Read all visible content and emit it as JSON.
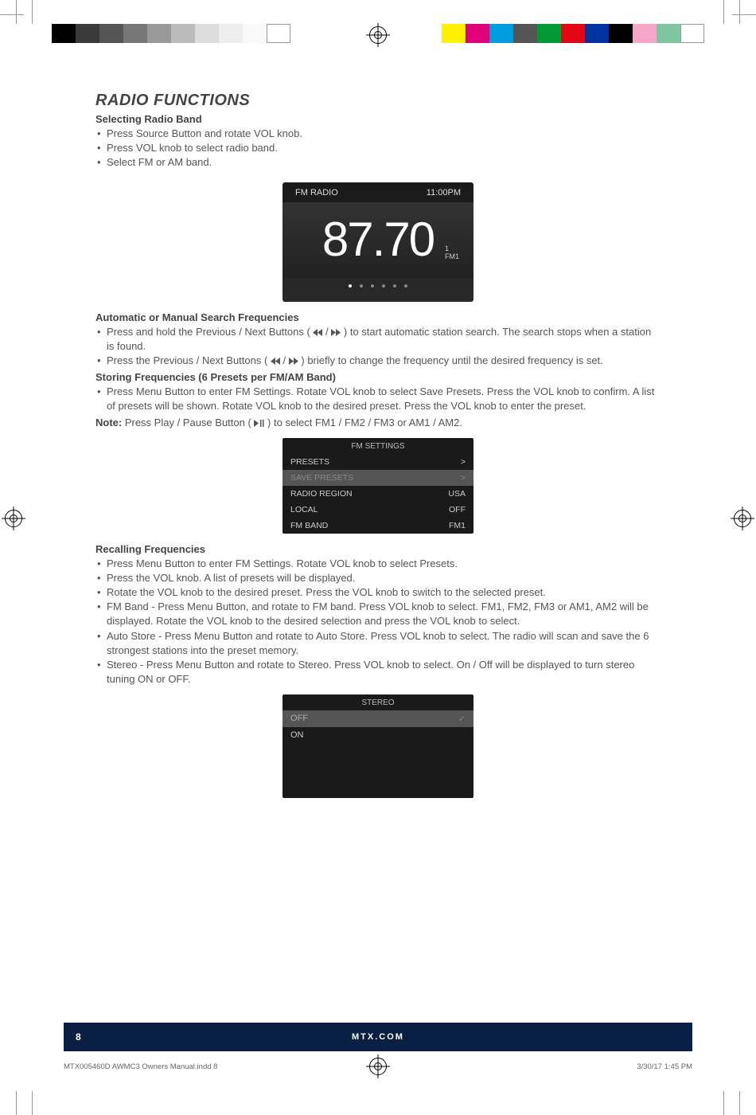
{
  "title": "RADIO FUNCTIONS",
  "section1": {
    "heading": "Selecting Radio Band",
    "items": [
      "Press Source Button and rotate VOL knob.",
      "Press VOL knob to select radio band.",
      "Select FM or AM band."
    ]
  },
  "display1": {
    "label": "FM RADIO",
    "time": "11:00PM",
    "frequency": "87.70",
    "preset_num": "1",
    "band": "FM1"
  },
  "section2": {
    "heading": "Automatic or Manual Search Frequencies",
    "item1a": "Press and hold the Previous / Next Buttons ( ",
    "item1b": " ) to start automatic station search. The search stops when a station is found.",
    "item2a": "Press the Previous / Next Buttons ( ",
    "item2b": " ) briefly to change the frequency until the desired frequency is set."
  },
  "section3": {
    "heading": "Storing Frequencies (6 Presets per FM/AM Band)",
    "item1": "Press Menu Button to enter FM Settings. Rotate VOL knob to select Save Presets. Press the VOL knob to confirm. A list of presets will be shown. Rotate VOL knob to the desired preset. Press the VOL knob to enter the preset.",
    "note_label": "Note:",
    "note_a": " Press Play / Pause Button (",
    "note_b": ") to select FM1 / FM2 / FM3 or AM1 / AM2."
  },
  "display2": {
    "title": "FM SETTINGS",
    "rows": [
      {
        "label": "PRESETS",
        "value": ">"
      },
      {
        "label": "SAVE PRESETS",
        "value": ">"
      },
      {
        "label": "RADIO REGION",
        "value": "USA"
      },
      {
        "label": "LOCAL",
        "value": "OFF"
      },
      {
        "label": "FM BAND",
        "value": "FM1"
      }
    ],
    "selected_index": 1
  },
  "section4": {
    "heading": "Recalling Frequencies",
    "items": [
      "Press Menu Button to enter FM Settings. Rotate VOL knob to select Presets.",
      "Press the VOL knob. A list of presets will be displayed.",
      "Rotate the VOL knob to the desired preset. Press the VOL knob to switch to the selected preset.",
      "FM  Band - Press Menu Button, and rotate to FM band. Press VOL knob to select. FM1, FM2, FM3 or AM1, AM2  will be displayed. Rotate the VOL knob to the desired selection and press the VOL knob to select.",
      "Auto Store - Press Menu Button and rotate to Auto Store. Press VOL knob to select. The radio will scan and save the 6 strongest stations into the preset memory.",
      "Stereo - Press Menu Button and rotate to Stereo. Press VOL knob to select. On / Off will be displayed to turn stereo tuning ON or OFF."
    ]
  },
  "display3": {
    "title": "STEREO",
    "rows": [
      {
        "label": "OFF",
        "checked": true
      },
      {
        "label": "ON",
        "checked": false
      }
    ],
    "selected_index": 0
  },
  "footer": {
    "page": "8",
    "site": "MTX.COM",
    "file": "MTX005460D AWMC3 Owners Manual.indd   8",
    "date": "3/30/17   1:45 PM"
  },
  "colorbars_left": [
    "#000",
    "#3a3a3a",
    "#555",
    "#777",
    "#999",
    "#bbb",
    "#ddd",
    "#eee",
    "#fafafa",
    "#fff"
  ],
  "colorbars_right": [
    "#fff000",
    "#e2007a",
    "#009ee0",
    "#555",
    "#009933",
    "#e30613",
    "#0033a0",
    "#000",
    "#f5a6c9",
    "#7ec6a0",
    "#fff"
  ]
}
